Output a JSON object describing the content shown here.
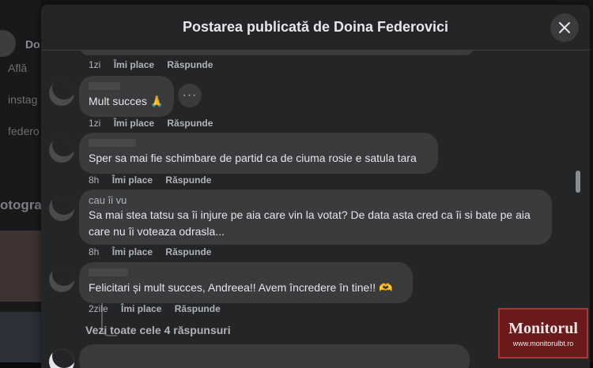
{
  "modal": {
    "title": "Postarea publicată de Doina Federovici"
  },
  "background": {
    "name_fragment": "Do",
    "lines": [
      "Află",
      "instag",
      "federo"
    ],
    "heading": "otogra"
  },
  "comments": [
    {
      "text": "",
      "actions": {
        "time": "1zi",
        "like": "Îmi place",
        "reply": "Răspunde"
      }
    },
    {
      "text": "Mult succes 🙏",
      "actions": {
        "time": "1zi",
        "like": "Îmi place",
        "reply": "Răspunde"
      }
    },
    {
      "text": "Sper sa mai fie schimbare de partid ca de ciuma rosie e satula tara",
      "actions": {
        "time": "8h",
        "like": "Îmi place",
        "reply": "Răspunde"
      }
    },
    {
      "author_fragment": "cau îi vu",
      "text": "Sa mai stea tatsu sa îi injure pe aia care vin la votat? De data asta cred ca îi si bate pe aia care nu îi voteaza odrasla...",
      "actions": {
        "time": "8h",
        "like": "Îmi place",
        "reply": "Răspunde"
      }
    },
    {
      "text": "Felicitari și mult succes, Andreea!! Avem încredere în tine!! 🫶",
      "actions": {
        "time": "2zile",
        "like": "Îmi place",
        "reply": "Răspunde"
      }
    }
  ],
  "view_replies": "Vezi toate cele 4 răspunsuri",
  "watermark": {
    "title": "Monitorul",
    "url": "www.monitorulbt.ro"
  }
}
